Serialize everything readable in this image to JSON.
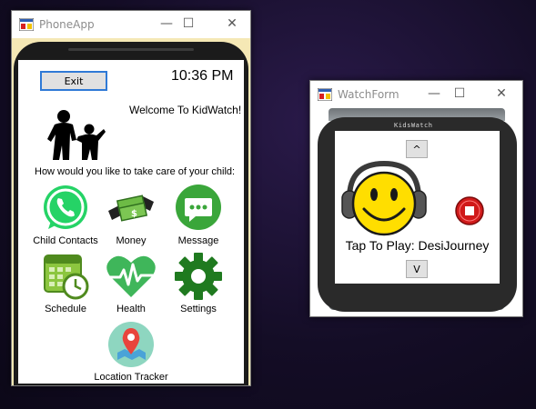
{
  "phone_window": {
    "title": "PhoneApp",
    "controls": {
      "minimize": "—",
      "maximize": "☐",
      "close": "✕"
    },
    "exit_label": "Exit",
    "time": "10:36 PM",
    "welcome": "Welcome To KidWatch!",
    "question": "How would you like to take care of your child:",
    "apps": [
      {
        "label": "Child Contacts",
        "icon": "whatsapp-phone-icon"
      },
      {
        "label": "Money",
        "icon": "money-icon"
      },
      {
        "label": "Message",
        "icon": "message-icon"
      },
      {
        "label": "Schedule",
        "icon": "calendar-clock-icon"
      },
      {
        "label": "Health",
        "icon": "heart-pulse-icon"
      },
      {
        "label": "Settings",
        "icon": "gear-icon"
      },
      {
        "label": "Location Tracker",
        "icon": "map-pin-icon"
      }
    ]
  },
  "watch_window": {
    "title": "WatchForm",
    "controls": {
      "minimize": "—",
      "maximize": "☐",
      "close": "✕"
    },
    "brand": "KidsWatch",
    "up_label": "^",
    "down_label": "V",
    "now_playing": "Tap To Play: DesiJourney"
  },
  "colors": {
    "accent_border": "#2f7ad6",
    "whatsapp_green": "#25d366",
    "app_green": "#3aa63a",
    "stop_red": "#d01a1a",
    "smiley_yellow": "#ffde00"
  }
}
